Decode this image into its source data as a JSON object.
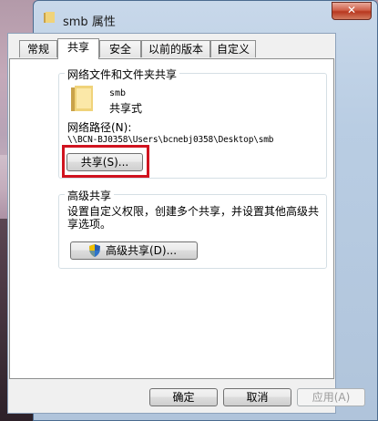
{
  "desktop": {
    "folder_label": "smb"
  },
  "window": {
    "title": "smb 属性",
    "close_label": "✕"
  },
  "tabs": [
    {
      "label": "常规"
    },
    {
      "label": "共享"
    },
    {
      "label": "安全"
    },
    {
      "label": "以前的版本"
    },
    {
      "label": "自定义"
    }
  ],
  "network_sharing": {
    "group_label": "网络文件和文件夹共享",
    "item_name": "smb",
    "item_status": "共享式",
    "path_label": "网络路径(N):",
    "path_value": "\\\\BCN-BJ0358\\Users\\bcnebj0358\\Desktop\\smb",
    "share_button": "共享(S)..."
  },
  "advanced_sharing": {
    "group_label": "高级共享",
    "description": "设置自定义权限，创建多个共享，并设置其他高级共享选项。",
    "button": "高级共享(D)..."
  },
  "footer": {
    "ok": "确定",
    "cancel": "取消",
    "apply": "应用(A)"
  },
  "colors": {
    "highlight_border": "#d0131f",
    "folder": "#e8c770"
  }
}
